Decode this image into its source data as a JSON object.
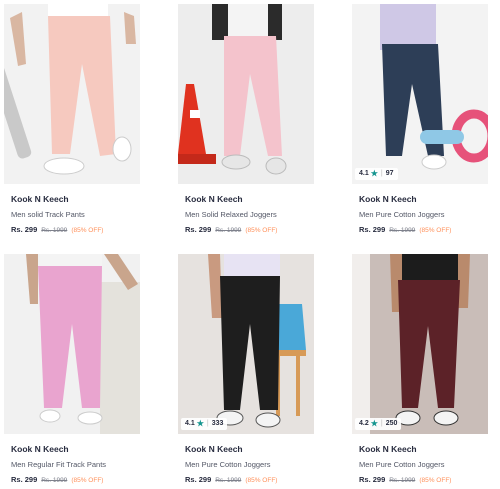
{
  "colors": {
    "star": "#14958f",
    "discount": "#ff905a"
  },
  "products": [
    {
      "brand": "Kook N Keech",
      "title": "Men solid Track Pants",
      "price": "Rs. 299",
      "mrp": "Rs. 1999",
      "discount": "(85% OFF)",
      "pant_color": "#f6c9bf",
      "bg_color": "#f2f2f2"
    },
    {
      "brand": "Kook N Keech",
      "title": "Men Solid Relaxed Joggers",
      "price": "Rs. 299",
      "mrp": "Rs. 1999",
      "discount": "(85% OFF)",
      "pant_color": "#f4c3cc",
      "bg_color": "#ededed"
    },
    {
      "brand": "Kook N Keech",
      "title": "Men Pure Cotton Joggers",
      "price": "Rs. 299",
      "mrp": "Rs. 1999",
      "discount": "(85% OFF)",
      "pant_color": "#2d3e57",
      "bg_color": "#f3f3f3",
      "rating": "4.1",
      "rating_count": "97"
    },
    {
      "brand": "Kook N Keech",
      "title": "Men Regular Fit Track Pants",
      "price": "Rs. 299",
      "mrp": "Rs. 1999",
      "discount": "(85% OFF)",
      "pant_color": "#e9a4cf",
      "bg_color": "#f1f1f1"
    },
    {
      "brand": "Kook N Keech",
      "title": "Men Pure Cotton Joggers",
      "price": "Rs. 299",
      "mrp": "Rs. 1999",
      "discount": "(85% OFF)",
      "pant_color": "#1e1e1e",
      "bg_color": "#e6e2df",
      "rating": "4.1",
      "rating_count": "333"
    },
    {
      "brand": "Kook N Keech",
      "title": "Men Pure Cotton Joggers",
      "price": "Rs. 299",
      "mrp": "Rs. 1999",
      "discount": "(85% OFF)",
      "pant_color": "#5c2228",
      "bg_color": "#c9bdb8",
      "rating": "4.2",
      "rating_count": "250"
    }
  ]
}
